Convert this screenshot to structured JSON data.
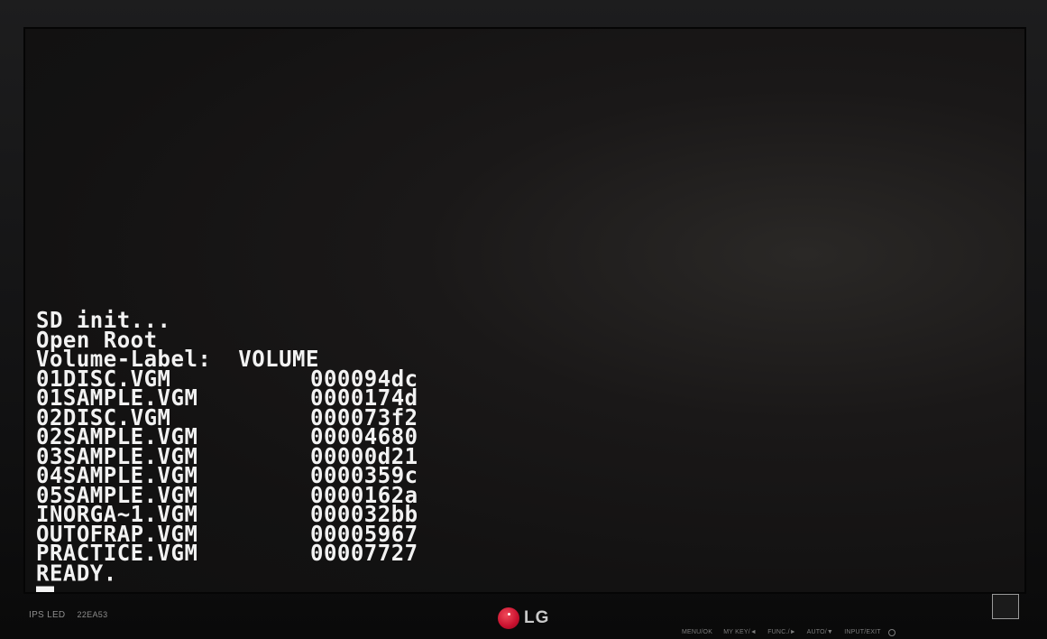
{
  "terminal": {
    "lines": [
      "SD init...",
      "Open Root",
      "Volume-Label:  VOLUME"
    ],
    "files": [
      {
        "name": "01DISC.VGM",
        "size": "000094dc"
      },
      {
        "name": "01SAMPLE.VGM",
        "size": "0000174d"
      },
      {
        "name": "02DISC.VGM",
        "size": "000073f2"
      },
      {
        "name": "02SAMPLE.VGM",
        "size": "00004680"
      },
      {
        "name": "03SAMPLE.VGM",
        "size": "00000d21"
      },
      {
        "name": "04SAMPLE.VGM",
        "size": "0000359c"
      },
      {
        "name": "05SAMPLE.VGM",
        "size": "0000162a"
      },
      {
        "name": "INORGA~1.VGM",
        "size": "000032bb"
      },
      {
        "name": "OUTOFRAP.VGM",
        "size": "00005967"
      },
      {
        "name": "PRACTICE.VGM",
        "size": "00007727"
      }
    ],
    "status": "READY."
  },
  "monitor": {
    "brand": "LG",
    "model": "IPS LED",
    "model_code": "22EA53",
    "controls": [
      "MENU/OK",
      "MY KEY/◄",
      "FUNC./►",
      "AUTO/▼",
      "INPUT/EXIT"
    ],
    "accent_color": "#c8102e"
  }
}
